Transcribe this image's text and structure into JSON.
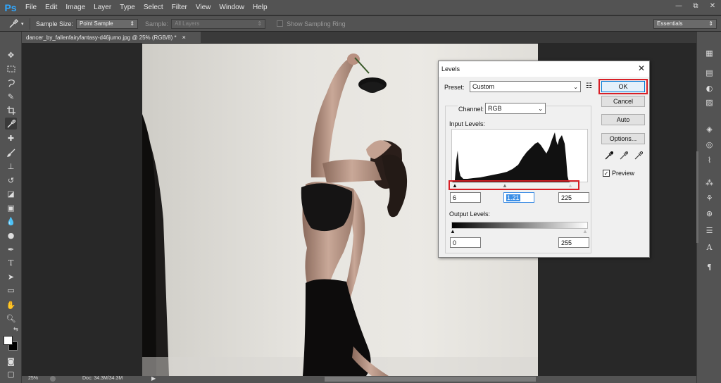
{
  "app": {
    "logo": "Ps",
    "menu": [
      "File",
      "Edit",
      "Image",
      "Layer",
      "Type",
      "Select",
      "Filter",
      "View",
      "Window",
      "Help"
    ],
    "window_controls": {
      "minimize": "—",
      "restore": "⧉",
      "close": "✕"
    }
  },
  "options_bar": {
    "sample_size_label": "Sample Size:",
    "sample_size_value": "Point Sample",
    "sample_label": "Sample:",
    "sample_value": "All Layers",
    "show_sampling_ring": "Show Sampling Ring",
    "workspace": "Essentials"
  },
  "document": {
    "tab_title": "dancer_by_fallenfairyfantasy-d46jumo.jpg @ 25% (RGB/8) *",
    "tab_close": "×"
  },
  "status_bar": {
    "zoom": "25%",
    "doc_info": "Doc: 34.3M/34.3M"
  },
  "levels_dialog": {
    "title": "Levels",
    "preset_label": "Preset:",
    "preset_value": "Custom",
    "channel_label": "Channel:",
    "channel_value": "RGB",
    "input_levels_label": "Input Levels:",
    "input_black": "6",
    "input_gamma": "1.21",
    "input_white": "225",
    "output_levels_label": "Output Levels:",
    "output_black": "0",
    "output_white": "255",
    "buttons": {
      "ok": "OK",
      "cancel": "Cancel",
      "auto": "Auto",
      "options": "Options..."
    },
    "preview_label": "Preview",
    "preview_checked": true,
    "highlight_color": "#d81f26"
  }
}
